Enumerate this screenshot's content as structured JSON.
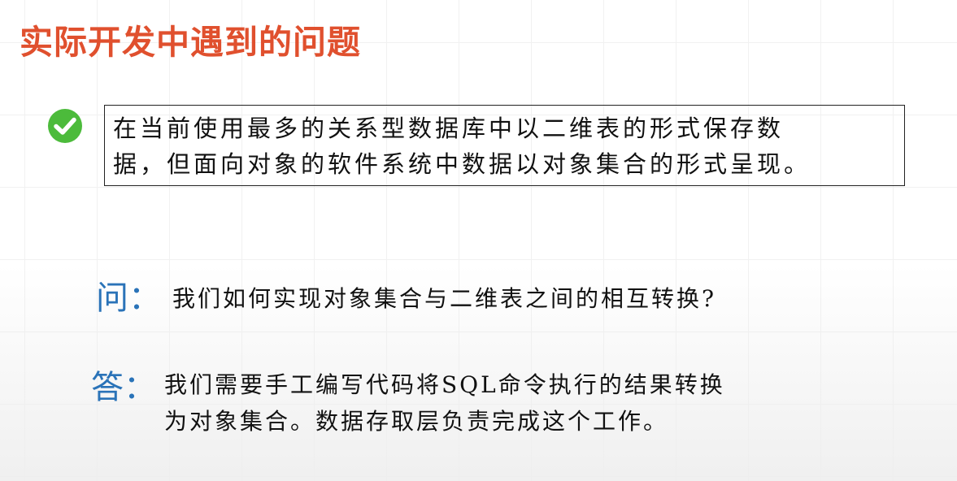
{
  "slide": {
    "title": "实际开发中遇到的问题",
    "statement": {
      "line1": "在当前使用最多的关系型数据库中以二维表的形式保存数",
      "line2": "据，但面向对象的软件系统中数据以对象集合的形式呈现。"
    },
    "question": {
      "label": "问：",
      "text": "我们如何实现对象集合与二维表之间的相互转换?"
    },
    "answer": {
      "label": "答：",
      "line1": "我们需要手工编写代码将SQL命令执行的结果转换",
      "line2": "为对象集合。数据存取层负责完成这个工作。"
    }
  },
  "colors": {
    "title": "#e0502e",
    "check": "#4cbb3b",
    "qa_label": "#2a73b8"
  },
  "icons": {
    "bullet": "check-circle-icon"
  }
}
